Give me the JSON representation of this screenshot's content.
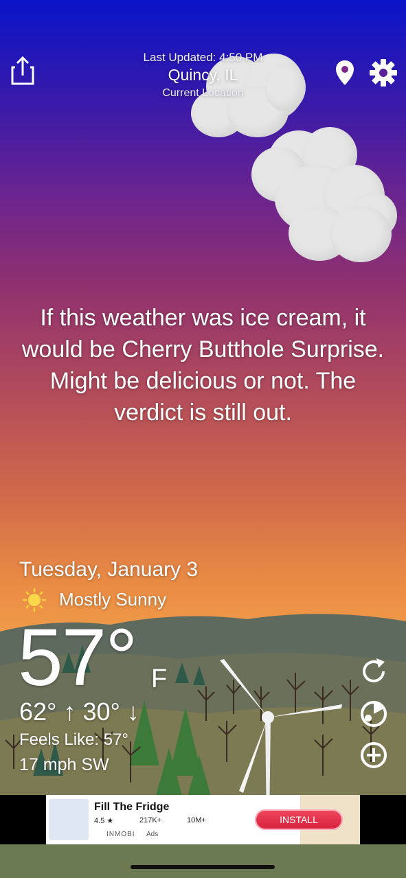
{
  "header": {
    "last_updated": "Last Updated: 4:50 PM",
    "city": "Quincy, IL",
    "location_label": "Current Location"
  },
  "icons": {
    "share": "share-icon",
    "location": "location-pin-icon",
    "settings": "gear-icon",
    "refresh": "refresh-icon",
    "radar": "radar-icon",
    "add": "add-circle-icon",
    "condition": "sun-icon"
  },
  "quip": "If this weather was ice cream, it would be Cherry Butthole Surprise. Might be delicious or not. The verdict is still out.",
  "weather": {
    "date": "Tuesday, January 3",
    "condition": "Mostly Sunny",
    "temperature": "57°",
    "unit": "F",
    "hi_lo": "62° ↑ 30° ↓",
    "feels_like": "Feels Like: 57°",
    "wind": "17 mph SW"
  },
  "ad": {
    "title": "Fill The Fridge",
    "rating": "4.5 ★",
    "reviews": "217K+",
    "downloads": "10M+",
    "brand": "INMOBI",
    "ads_label": "Ads",
    "install_label": "INSTALL"
  },
  "colors": {
    "sky_top": "#0a14c8",
    "sky_bottom": "#f2a04c",
    "install": "#e0304a"
  }
}
